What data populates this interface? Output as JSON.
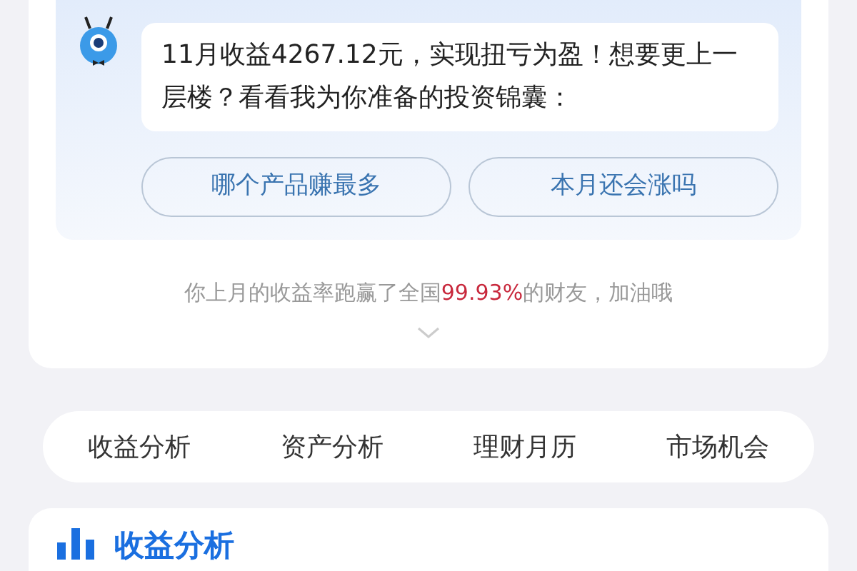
{
  "assistant": {
    "message": "11月收益4267.12元，实现扭亏为盈！想要更上一层楼？看看我为你准备的投资锦囊：",
    "suggestions": [
      "哪个产品赚最多",
      "本月还会涨吗"
    ]
  },
  "ranking": {
    "before": "你上月的收益率跑赢了全国",
    "highlight": "99.93%",
    "after": "的财友，加油哦"
  },
  "tabs": [
    {
      "label": "收益分析",
      "selected": false
    },
    {
      "label": "资产分析",
      "selected": false
    },
    {
      "label": "理财月历",
      "selected": false
    },
    {
      "label": "市场机会",
      "selected": false
    }
  ],
  "section": {
    "title": "收益分析"
  }
}
